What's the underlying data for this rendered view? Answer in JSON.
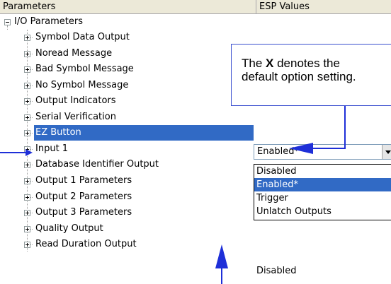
{
  "header": {
    "col_parameters": "Parameters",
    "col_esp_values": "ESP Values"
  },
  "tree": {
    "root": {
      "label": "I/O Parameters"
    },
    "items": [
      {
        "label": "Symbol Data Output"
      },
      {
        "label": "Noread Message"
      },
      {
        "label": "Bad Symbol Message"
      },
      {
        "label": "No Symbol Message"
      },
      {
        "label": "Output Indicators"
      },
      {
        "label": "Serial Verification"
      },
      {
        "label": "EZ Button"
      },
      {
        "label": "Input 1"
      },
      {
        "label": "Database Identifier Output"
      },
      {
        "label": "Output 1 Parameters"
      },
      {
        "label": "Output 2 Parameters"
      },
      {
        "label": "Output 3 Parameters"
      },
      {
        "label": "Quality Output"
      },
      {
        "label": "Read Duration Output"
      }
    ]
  },
  "values": {
    "ez_button_selected": "Enabled*",
    "read_duration_output": "Disabled"
  },
  "dropdown": {
    "options": [
      "Disabled",
      "Enabled*",
      "Trigger",
      "Unlatch Outputs"
    ],
    "selected_index": 1
  },
  "callout": {
    "prefix": "The ",
    "bold": "X",
    "suffix": " denotes the",
    "line2": "default option setting."
  },
  "colors": {
    "selection": "#316ac5",
    "annotation": "#1e2fd8"
  }
}
